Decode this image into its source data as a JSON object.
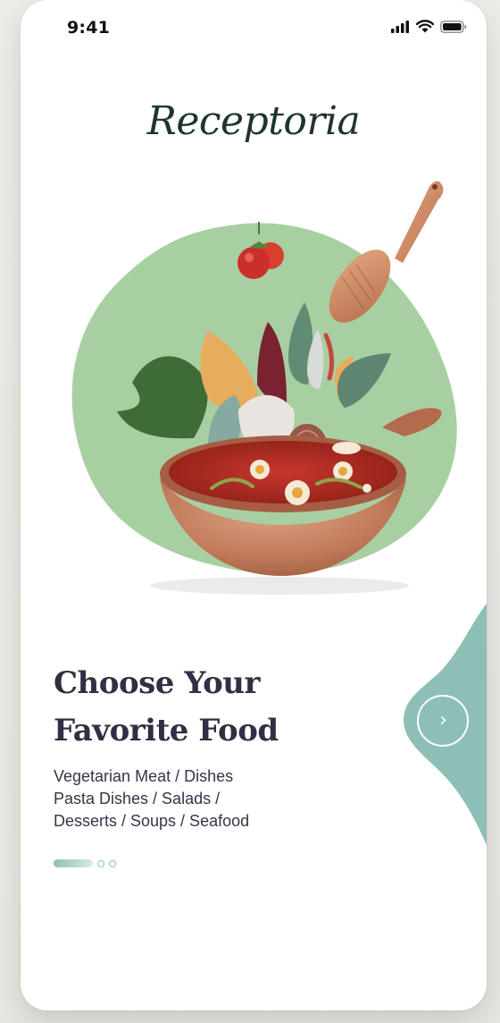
{
  "status_bar": {
    "time": "9:41",
    "icons": [
      "signal-icon",
      "wifi-icon",
      "battery-icon"
    ]
  },
  "app": {
    "brand": "Receptoria"
  },
  "onboarding": {
    "headline_line1": "Choose Your",
    "headline_line2": "Favorite Food",
    "description_lines": [
      "Vegetarian Meat / Dishes",
      "Pasta Dishes / Salads /",
      "Desserts / Soups / Seafood"
    ],
    "pager": {
      "total": 3,
      "active_index": 0
    },
    "next_button": {
      "icon": "chevron-right-icon",
      "symbol": "›"
    }
  },
  "colors": {
    "accent_teal": "#8dbfb7",
    "hero_green": "#a8cfa2",
    "headline_text": "#2f3044",
    "body_text": "#353549",
    "brand_text": "#1f3432"
  }
}
